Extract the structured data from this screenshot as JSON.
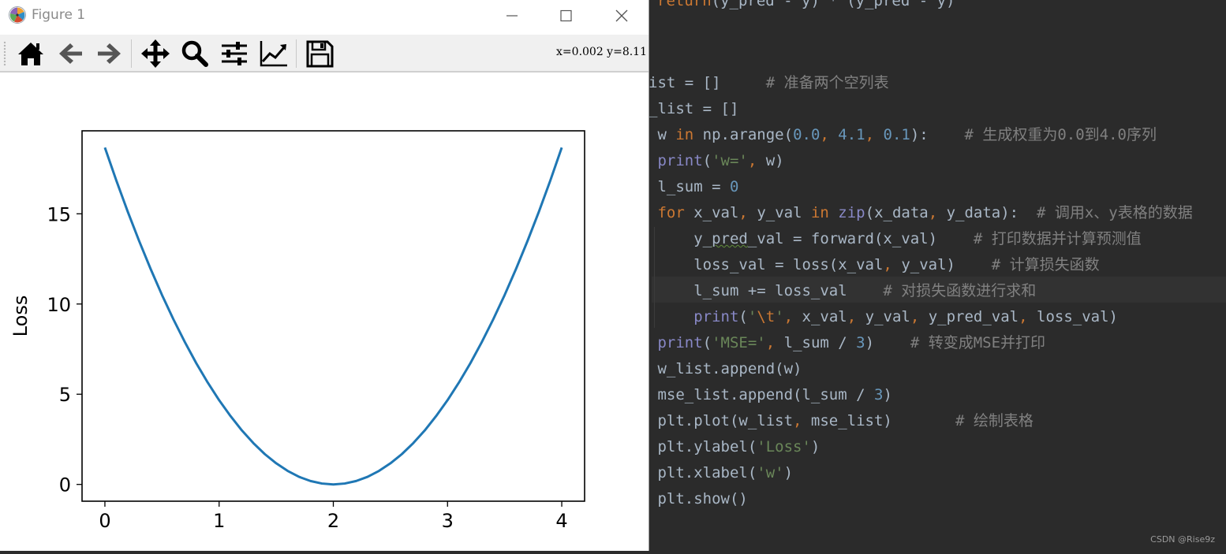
{
  "figure_window": {
    "title": "Figure 1",
    "toolbar": {
      "buttons": [
        {
          "name": "home",
          "icon": "home-icon"
        },
        {
          "name": "back",
          "icon": "arrow-left-icon"
        },
        {
          "name": "forward",
          "icon": "arrow-right-icon"
        },
        {
          "name": "pan",
          "icon": "move-icon"
        },
        {
          "name": "zoom",
          "icon": "magnifier-icon"
        },
        {
          "name": "configure-subplots",
          "icon": "sliders-icon"
        },
        {
          "name": "edit-axes",
          "icon": "line-chart-icon"
        },
        {
          "name": "save",
          "icon": "floppy-disk-icon"
        }
      ],
      "coordinates": "x=0.002 y=8.11"
    }
  },
  "chart_data": {
    "type": "line",
    "title": "",
    "xlabel": "",
    "ylabel": "Loss",
    "x": [
      0.0,
      0.1,
      0.2,
      0.3,
      0.4,
      0.5,
      0.6,
      0.7,
      0.8,
      0.9,
      1.0,
      1.1,
      1.2,
      1.3,
      1.4,
      1.5,
      1.6,
      1.7,
      1.8,
      1.9,
      2.0,
      2.1,
      2.2,
      2.3,
      2.4,
      2.5,
      2.6,
      2.7,
      2.8,
      2.9,
      3.0,
      3.1,
      3.2,
      3.3,
      3.4,
      3.5,
      3.6,
      3.7,
      3.8,
      3.9,
      4.0
    ],
    "y": [
      18.67,
      16.85,
      15.12,
      13.49,
      11.95,
      10.5,
      9.15,
      7.89,
      6.72,
      5.65,
      4.67,
      3.79,
      2.99,
      2.29,
      1.68,
      1.17,
      0.75,
      0.42,
      0.19,
      0.05,
      0.0,
      0.05,
      0.19,
      0.42,
      0.75,
      1.17,
      1.68,
      2.29,
      2.99,
      3.79,
      4.67,
      5.65,
      6.72,
      7.89,
      9.15,
      10.5,
      11.95,
      13.49,
      15.12,
      16.85,
      18.67
    ],
    "xticks": [
      "0",
      "1",
      "2",
      "3",
      "4"
    ],
    "yticks": [
      "0",
      "5",
      "10",
      "15"
    ],
    "xlim": [
      -0.2,
      4.2
    ],
    "ylim": [
      -0.93,
      19.6
    ],
    "grid": false,
    "line_color": "#1f77b4"
  },
  "editor": {
    "lines": [
      [
        {
          "t": "return",
          "c": "kw"
        },
        {
          "t": "(y_pred - y) * (y_pred - y)",
          "c": ""
        }
      ],
      [],
      [],
      [
        {
          "t": "ist = []     ",
          "c": ""
        },
        {
          "t": "# 准备两个空列表",
          "c": "cmt"
        }
      ],
      [
        {
          "t": "_list = []",
          "c": ""
        }
      ],
      [
        {
          "t": " w ",
          "c": ""
        },
        {
          "t": "in",
          "c": "kw"
        },
        {
          "t": " np.arange(",
          "c": ""
        },
        {
          "t": "0.0",
          "c": "num"
        },
        {
          "t": ", ",
          "c": "kw"
        },
        {
          "t": "4.1",
          "c": "num"
        },
        {
          "t": ", ",
          "c": "kw"
        },
        {
          "t": "0.1",
          "c": "num"
        },
        {
          "t": "):    ",
          "c": ""
        },
        {
          "t": "# 生成权重为0.0到4.0序列",
          "c": "cmt"
        }
      ],
      [
        {
          "t": " ",
          "c": ""
        },
        {
          "t": "print",
          "c": "bi"
        },
        {
          "t": "(",
          "c": ""
        },
        {
          "t": "'w='",
          "c": "str"
        },
        {
          "t": ", ",
          "c": "kw"
        },
        {
          "t": "w)",
          "c": ""
        }
      ],
      [
        {
          "t": " l_sum = ",
          "c": ""
        },
        {
          "t": "0",
          "c": "num"
        }
      ],
      [
        {
          "t": " ",
          "c": ""
        },
        {
          "t": "for",
          "c": "kw"
        },
        {
          "t": " x_val",
          "c": ""
        },
        {
          "t": ", ",
          "c": "kw"
        },
        {
          "t": "y_val ",
          "c": ""
        },
        {
          "t": "in",
          "c": "kw"
        },
        {
          "t": " ",
          "c": ""
        },
        {
          "t": "zip",
          "c": "bi"
        },
        {
          "t": "(x_data",
          "c": ""
        },
        {
          "t": ", ",
          "c": "kw"
        },
        {
          "t": "y_data):  ",
          "c": ""
        },
        {
          "t": "# 调用x、y表格的数据",
          "c": "cmt"
        }
      ],
      [
        {
          "t": "     y_",
          "c": ""
        },
        {
          "t": "pred",
          "c": "squig"
        },
        {
          "t": "_val = forward(x_val)    ",
          "c": ""
        },
        {
          "t": "# 打印数据并计算预测值",
          "c": "cmt"
        }
      ],
      [
        {
          "t": "     loss_val = loss(x_val",
          "c": ""
        },
        {
          "t": ", ",
          "c": "kw"
        },
        {
          "t": "y_val)    ",
          "c": ""
        },
        {
          "t": "# 计算损失函数",
          "c": "cmt"
        }
      ],
      [
        {
          "t": "     l_sum += loss_val    ",
          "c": ""
        },
        {
          "t": "# 对损失函数进行求和",
          "c": "cmt"
        }
      ],
      [
        {
          "t": "     ",
          "c": ""
        },
        {
          "t": "print",
          "c": "bi"
        },
        {
          "t": "(",
          "c": ""
        },
        {
          "t": "'",
          "c": "str"
        },
        {
          "t": "\\t",
          "c": "esc"
        },
        {
          "t": "'",
          "c": "str"
        },
        {
          "t": ", ",
          "c": "kw"
        },
        {
          "t": "x_val",
          "c": ""
        },
        {
          "t": ", ",
          "c": "kw"
        },
        {
          "t": "y_val",
          "c": ""
        },
        {
          "t": ", ",
          "c": "kw"
        },
        {
          "t": "y_pred_val",
          "c": ""
        },
        {
          "t": ", ",
          "c": "kw"
        },
        {
          "t": "loss_val)",
          "c": ""
        }
      ],
      [
        {
          "t": " ",
          "c": ""
        },
        {
          "t": "print",
          "c": "bi"
        },
        {
          "t": "(",
          "c": ""
        },
        {
          "t": "'MSE='",
          "c": "str"
        },
        {
          "t": ", ",
          "c": "kw"
        },
        {
          "t": "l_sum / ",
          "c": ""
        },
        {
          "t": "3",
          "c": "num"
        },
        {
          "t": ")    ",
          "c": ""
        },
        {
          "t": "# 转变成MSE并打印",
          "c": "cmt"
        }
      ],
      [
        {
          "t": " w_list.append(w)",
          "c": ""
        }
      ],
      [
        {
          "t": " mse_list.append(l_sum / ",
          "c": ""
        },
        {
          "t": "3",
          "c": "num"
        },
        {
          "t": ")",
          "c": ""
        }
      ],
      [
        {
          "t": " plt.plot(w_list",
          "c": ""
        },
        {
          "t": ", ",
          "c": "kw"
        },
        {
          "t": "mse_list)       ",
          "c": ""
        },
        {
          "t": "# 绘制表格",
          "c": "cmt"
        }
      ],
      [
        {
          "t": " plt.ylabel(",
          "c": ""
        },
        {
          "t": "'Loss'",
          "c": "str"
        },
        {
          "t": ")",
          "c": ""
        }
      ],
      [
        {
          "t": " plt.xlabel(",
          "c": ""
        },
        {
          "t": "'w'",
          "c": "str"
        },
        {
          "t": ")",
          "c": ""
        }
      ],
      [
        {
          "t": " plt.show()",
          "c": ""
        }
      ]
    ],
    "watermark": "CSDN @Rise9z"
  }
}
